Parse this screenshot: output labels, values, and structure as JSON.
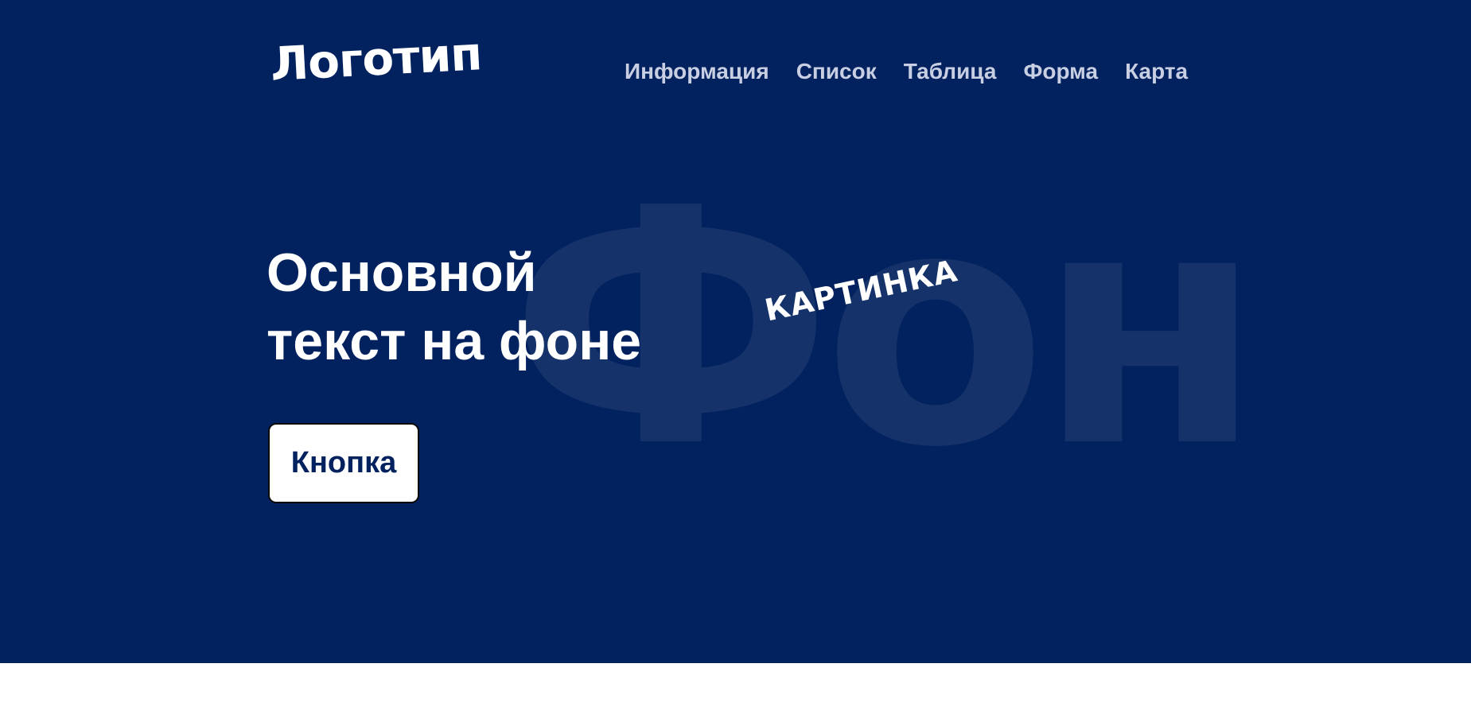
{
  "header": {
    "logo_text": "Логотип",
    "nav": [
      {
        "label": "Информация"
      },
      {
        "label": "Список"
      },
      {
        "label": "Таблица"
      },
      {
        "label": "Форма"
      },
      {
        "label": "Карта"
      }
    ]
  },
  "hero": {
    "background_color": "#02215f",
    "watermark_text": "Фон",
    "headline_line1": "Основной",
    "headline_line2": "текст на фоне",
    "image_label": "КАРТИНКА",
    "button_label": "Кнопка"
  }
}
